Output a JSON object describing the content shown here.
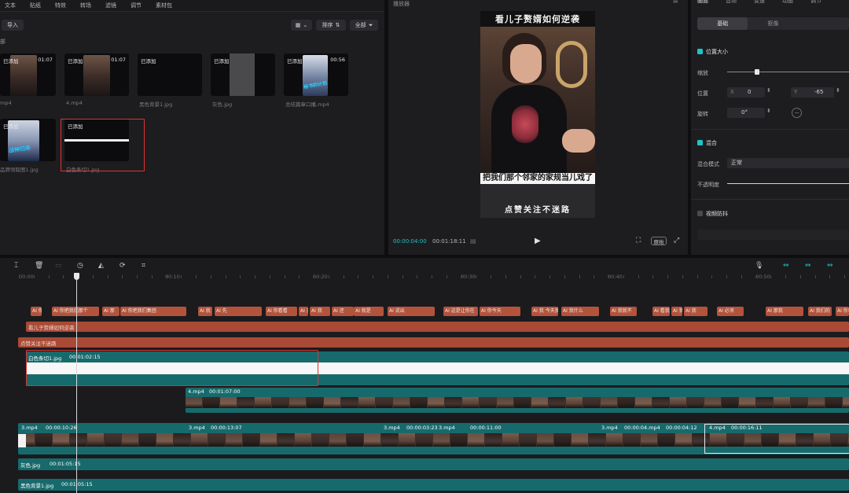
{
  "topnav": [
    "文本",
    "贴纸",
    "特效",
    "转场",
    "滤镜",
    "调节",
    "素材包"
  ],
  "media": {
    "import_label": "导入",
    "section_label": "部",
    "sort_label": "排序",
    "all_label": "全部",
    "items": [
      {
        "tag": "已添加",
        "duration": "01:07",
        "name": "mp4"
      },
      {
        "tag": "已添加",
        "duration": "01:07",
        "name": "4.mp4"
      },
      {
        "tag": "已添加",
        "duration": "",
        "name": "黑色背景1.jpg"
      },
      {
        "tag": "已添加",
        "duration": "",
        "name": "灰色.jpg"
      },
      {
        "tag": "已添加",
        "duration": "00:56",
        "name": "总结篇章口播.mp4"
      },
      {
        "tag": "已添加",
        "duration": "",
        "name": "品牌领取图1.jpg"
      },
      {
        "tag": "已添加",
        "duration": "",
        "name": "白色条切1.jpg"
      }
    ],
    "thumb_texts": [
      "战神归来",
      "秘书的计划"
    ]
  },
  "player": {
    "title": "播放器",
    "caption_top": "看儿子赘婿如何逆袭",
    "caption_mid": "把我们那个邻家的家规当儿戏了",
    "caption_bottom": "点赞关注不迷路",
    "time_current": "00:00:04:00",
    "time_total": "00:01:18:11",
    "ratio_label": "原始"
  },
  "props": {
    "tabs": [
      "画面",
      "音频",
      "变速",
      "动画",
      "调节"
    ],
    "subtabs": [
      "基础",
      "抠像",
      ""
    ],
    "section_position": "位置大小",
    "scale_label": "缩放",
    "position_label": "位置",
    "pos_x_label": "X",
    "pos_x": "0",
    "pos_y_label": "Y",
    "pos_y": "-65",
    "rotate_label": "旋转",
    "rotate_value": "0°",
    "section_blend": "混合",
    "blend_mode_label": "混合模式",
    "blend_mode_value": "正常",
    "opacity_label": "不透明度",
    "section_stabilize": "视频防抖"
  },
  "timeline": {
    "ruler": [
      "00:00",
      "00:10",
      "00:20",
      "00:30",
      "00:40",
      "00:50"
    ],
    "chips": [
      "AI 你把",
      "AI 你把我们那个",
      "AI 那",
      "AI 你把我们集团",
      "AI 就",
      "AI 先",
      "AI 你看看",
      "AI 天天",
      "AI 我",
      "AI 还",
      "AI 就是",
      "AI 说出",
      "AI 这是让你在",
      "AI 你今天",
      "AI 我 今天我",
      "AI 我什么",
      "AI 我就不",
      "AI 看我",
      "AI 我",
      "AI 我",
      "AI 必须",
      "AI 那我",
      "AI 我们的",
      "AI 你看"
    ],
    "text_track_1": "看儿子赘婿如何逆袭",
    "text_track_2": "点赞关注不迷路",
    "white_clip": {
      "name": "白色条切1.jpg",
      "time": "00:01:02:15"
    },
    "video_upper": {
      "name": "4.mp4",
      "time": "00:01:07:00"
    },
    "main_clips": [
      {
        "name": "3.mp4",
        "time": "00:00:10:26"
      },
      {
        "name": "3.mp4",
        "time": "00:00:13:07"
      },
      {
        "name": "3.mp4",
        "time": "00:00:03:23"
      },
      {
        "name": "3.mp4",
        "time": "00:00:11:00"
      },
      {
        "name": "3.mp4",
        "time": "00:00:0"
      },
      {
        "name": "4.mp4",
        "time": "00:00:04:12"
      },
      {
        "name": "4.mp4",
        "time": "00:00:16:11"
      }
    ],
    "gray_clip": {
      "name": "灰色.jpg",
      "time": "00:01:05:15"
    },
    "black_clip": {
      "name": "黑色背景1.jpg",
      "time": "00:01:05:15"
    }
  }
}
